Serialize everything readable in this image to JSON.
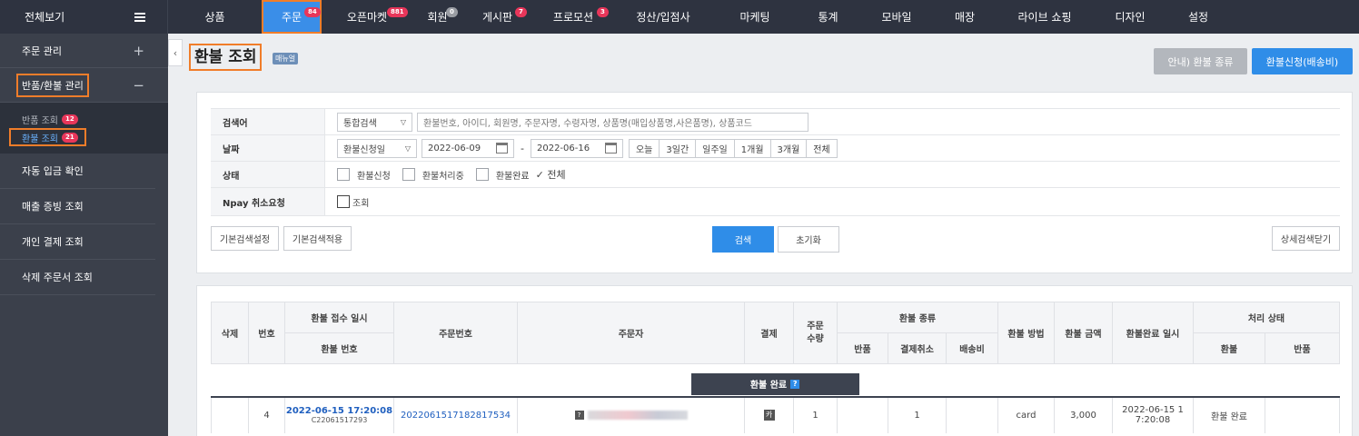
{
  "topbar": {
    "allview_label": "전체보기",
    "menu": [
      {
        "label": "상품",
        "badge": ""
      },
      {
        "label": "주문",
        "badge": "84"
      },
      {
        "label": "오픈마켓",
        "badge": "881"
      },
      {
        "label": "회원",
        "badge": "0"
      },
      {
        "label": "게시판",
        "badge": "7"
      },
      {
        "label": "프로모션",
        "badge": "3"
      },
      {
        "label": "정산/입점사",
        "badge": ""
      },
      {
        "label": "마케팅",
        "badge": ""
      },
      {
        "label": "통계",
        "badge": ""
      },
      {
        "label": "모바일",
        "badge": ""
      },
      {
        "label": "매장",
        "badge": ""
      },
      {
        "label": "라이브 쇼핑",
        "badge": ""
      },
      {
        "label": "디자인",
        "badge": ""
      },
      {
        "label": "설정",
        "badge": ""
      }
    ]
  },
  "sidebar": {
    "order_mgmt": "주문 관리",
    "order_mgmt_sign": "+",
    "return_mgmt": "반품/환불 관리",
    "return_mgmt_sign": "−",
    "sub": [
      {
        "label": "반품 조회",
        "count": "12"
      },
      {
        "label": "환불 조회",
        "count": "21"
      }
    ],
    "items": [
      "자동 입금 확인",
      "매출 증빙 조회",
      "개인 결제 조회",
      "삭제 주문서 조회"
    ]
  },
  "header": {
    "title": "환불 조회",
    "manual": "매뉴얼",
    "guide_btn": "안내) 환불 종류",
    "apply_btn": "환불신청(배송비)"
  },
  "search": {
    "keyword_label": "검색어",
    "keyword_select": "통합검색",
    "keyword_placeholder": "환불번호, 아이디, 회원명, 주문자명, 수령자명, 상품명(매입상품명,사은품명), 상품코드",
    "date_label": "날짜",
    "date_select": "환불신청일",
    "date_from": "2022-06-09",
    "date_sep": "-",
    "date_to": "2022-06-16",
    "quick": [
      "오늘",
      "3일간",
      "일주일",
      "1개월",
      "3개월",
      "전체"
    ],
    "status_label": "상태",
    "status_options": [
      "환불신청",
      "환불처리중",
      "환불완료"
    ],
    "status_all": "✓ 전체",
    "npay_label": "Npay 취소요청",
    "npay_option": "조회",
    "btn_default_set": "기본검색설정",
    "btn_default_apply": "기본검색적용",
    "btn_search": "검색",
    "btn_reset": "초기화",
    "btn_detail_close": "상세검색닫기"
  },
  "table": {
    "headers": {
      "delete": "삭제",
      "no": "번호",
      "received_at": "환불 접수 일시",
      "refund_no": "환불 번호",
      "order_no": "주문번호",
      "orderer": "주문자",
      "payment": "결제",
      "order_qty": "주문 수량",
      "refund_type": "환불 종류",
      "type_return": "반품",
      "type_cancel": "결제취소",
      "type_shipping": "배송비",
      "refund_method": "환불 방법",
      "refund_amount": "환불 금액",
      "refund_done_at": "환불완료 일시",
      "proc_status": "처리 상태",
      "proc_refund": "환불",
      "proc_return": "반품"
    },
    "group_label": "환불 완료",
    "group_help": "?",
    "rows": [
      {
        "no": "4",
        "received_at": "2022-06-15 17:20:08",
        "refund_no": "C22061517293",
        "order_no": "2022061517182817534",
        "orderer_icon": "?",
        "payment_icon": "카",
        "qty": "1",
        "type_return": "",
        "type_cancel": "1",
        "type_shipping": "",
        "method": "card",
        "amount": "3,000",
        "done_at_1": "2022-06-15 1",
        "done_at_2": "7:20:08",
        "status_refund": "환불 완료",
        "status_return": ""
      }
    ]
  },
  "colors": {
    "topbar_bg": "#2e3340",
    "active_tab": "#3a8ee8",
    "highlight": "#f07d2a",
    "badge": "#e8365a",
    "primary": "#2f8de8"
  }
}
